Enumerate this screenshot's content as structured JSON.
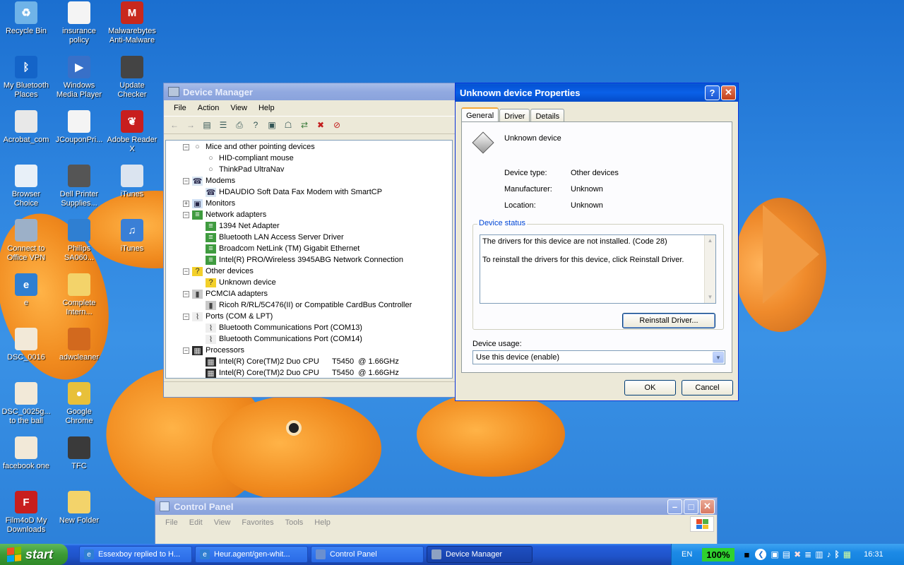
{
  "desktop": {
    "icons": [
      {
        "label": "Recycle Bin",
        "icon": "recycle-bin-icon"
      },
      {
        "label": "insurance policy",
        "icon": "document-icon"
      },
      {
        "label": "Malwarebytes Anti-Malware",
        "icon": "malwarebytes-icon"
      },
      {
        "label": "My Bluetooth Places",
        "icon": "bluetooth-icon"
      },
      {
        "label": "Windows Media Player",
        "icon": "media-player-icon"
      },
      {
        "label": "Update Checker",
        "icon": "update-checker-icon"
      },
      {
        "label": "Acrobat_com",
        "icon": "acrobat-icon"
      },
      {
        "label": "JCouponPri...",
        "icon": "document-icon"
      },
      {
        "label": "Adobe Reader X",
        "icon": "adobe-reader-icon"
      },
      {
        "label": "Browser Choice",
        "icon": "browser-choice-icon"
      },
      {
        "label": "Dell Printer Supplies...",
        "icon": "printer-icon"
      },
      {
        "label": "iTunes",
        "icon": "itunes-window-icon"
      },
      {
        "label": "Connect to Office VPN",
        "icon": "vpn-icon"
      },
      {
        "label": "Philips SA060...",
        "icon": "philips-icon"
      },
      {
        "label": "iTunes",
        "icon": "itunes-icon"
      },
      {
        "label": "e",
        "icon": "internet-explorer-icon"
      },
      {
        "label": "Complete Intern...",
        "icon": "folder-icon"
      },
      {
        "label": "DSC_0016",
        "icon": "image-file-icon"
      },
      {
        "label": "adwcleaner",
        "icon": "adwcleaner-icon"
      },
      {
        "label": "DSC_0025g... to the ball",
        "icon": "image-file-icon"
      },
      {
        "label": "Google Chrome",
        "icon": "chrome-icon"
      },
      {
        "label": "facebook one",
        "icon": "image-file-icon"
      },
      {
        "label": "TFC",
        "icon": "trash-can-icon"
      },
      {
        "label": "Film4oD My Downloads",
        "icon": "film4od-icon"
      },
      {
        "label": "New Folder",
        "icon": "folder-icon"
      }
    ]
  },
  "device_manager": {
    "title": "Device Manager",
    "menu": [
      "File",
      "Action",
      "View",
      "Help"
    ],
    "tree": [
      {
        "label": "Mice and other pointing devices",
        "level": 0,
        "expander": "−",
        "icon": "mouse-icon"
      },
      {
        "label": "HID-compliant mouse",
        "level": 1,
        "icon": "mouse-icon"
      },
      {
        "label": "ThinkPad UltraNav",
        "level": 1,
        "icon": "mouse-icon"
      },
      {
        "label": "Modems",
        "level": 0,
        "expander": "−",
        "icon": "modem-icon"
      },
      {
        "label": "HDAUDIO Soft Data Fax Modem with SmartCP",
        "level": 1,
        "icon": "modem-icon"
      },
      {
        "label": "Monitors",
        "level": 0,
        "expander": "+",
        "icon": "monitor-icon"
      },
      {
        "label": "Network adapters",
        "level": 0,
        "expander": "−",
        "icon": "network-card-icon"
      },
      {
        "label": "1394 Net Adapter",
        "level": 1,
        "icon": "network-card-icon"
      },
      {
        "label": "Bluetooth LAN Access Server Driver",
        "level": 1,
        "icon": "network-card-icon"
      },
      {
        "label": "Broadcom NetLink (TM) Gigabit Ethernet",
        "level": 1,
        "icon": "network-card-icon"
      },
      {
        "label": "Intel(R) PRO/Wireless 3945ABG Network Connection",
        "level": 1,
        "icon": "network-card-icon"
      },
      {
        "label": "Other devices",
        "level": 0,
        "expander": "−",
        "icon": "unknown-device-icon"
      },
      {
        "label": "Unknown device",
        "level": 1,
        "icon": "unknown-device-icon"
      },
      {
        "label": "PCMCIA adapters",
        "level": 0,
        "expander": "−",
        "icon": "pcmcia-icon"
      },
      {
        "label": "Ricoh R/RL/5C476(II) or Compatible CardBus Controller",
        "level": 1,
        "icon": "pcmcia-icon"
      },
      {
        "label": "Ports (COM & LPT)",
        "level": 0,
        "expander": "−",
        "icon": "port-icon"
      },
      {
        "label": "Bluetooth Communications Port (COM13)",
        "level": 1,
        "icon": "port-icon"
      },
      {
        "label": "Bluetooth Communications Port (COM14)",
        "level": 1,
        "icon": "port-icon"
      },
      {
        "label": "Processors",
        "level": 0,
        "expander": "−",
        "icon": "processor-icon"
      },
      {
        "label": "Intel(R) Core(TM)2 Duo CPU      T5450  @ 1.66GHz",
        "level": 1,
        "icon": "processor-icon"
      },
      {
        "label": "Intel(R) Core(TM)2 Duo CPU      T5450  @ 1.66GHz",
        "level": 1,
        "icon": "processor-icon"
      }
    ]
  },
  "properties": {
    "title": "Unknown device Properties",
    "tabs": [
      "General",
      "Driver",
      "Details"
    ],
    "device_name": "Unknown device",
    "fields": [
      {
        "label": "Device type:",
        "value": "Other devices"
      },
      {
        "label": "Manufacturer:",
        "value": "Unknown"
      },
      {
        "label": "Location:",
        "value": "Unknown"
      }
    ],
    "status_title": "Device status",
    "status_line1": "The drivers for this device are not installed. (Code 28)",
    "status_line2": "To reinstall the drivers for this device, click Reinstall Driver.",
    "reinstall_label": "Reinstall Driver...",
    "usage_label": "Device usage:",
    "usage_value": "Use this device (enable)",
    "ok_label": "OK",
    "cancel_label": "Cancel"
  },
  "control_panel": {
    "title": "Control Panel",
    "menu": [
      "File",
      "Edit",
      "View",
      "Favorites",
      "Tools",
      "Help"
    ]
  },
  "taskbar": {
    "start_label": "start",
    "tasks": [
      {
        "label": "Essexboy replied to H...",
        "icon": "internet-explorer-icon",
        "active": false
      },
      {
        "label": "Heur.agent/gen-whit...",
        "icon": "internet-explorer-icon",
        "active": false
      },
      {
        "label": "Control Panel",
        "icon": "control-panel-icon",
        "active": false
      },
      {
        "label": "Device Manager",
        "icon": "device-manager-icon",
        "active": true
      }
    ],
    "language": "EN",
    "battery": "100%",
    "clock": "16:31"
  }
}
